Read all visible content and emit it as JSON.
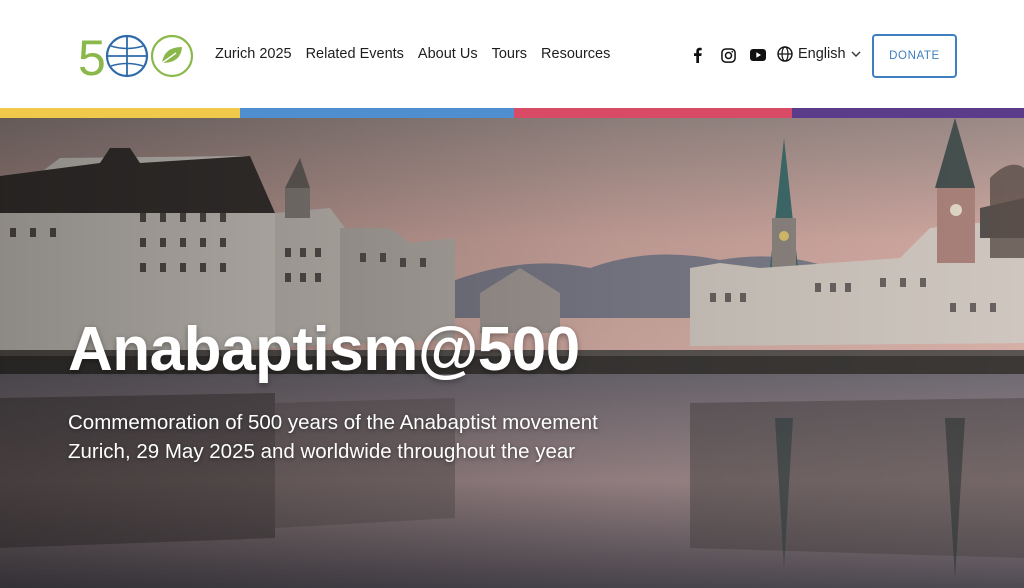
{
  "logo": {
    "text": "5",
    "icon_names": [
      "globe-icon",
      "leaf-icon"
    ]
  },
  "nav": {
    "items": [
      "Zurich 2025",
      "Related Events",
      "About Us",
      "Tours",
      "Resources"
    ]
  },
  "social": [
    "facebook-icon",
    "instagram-icon",
    "youtube-icon"
  ],
  "language": {
    "icon": "globe-icon",
    "label": "English",
    "dropdown_icon": "chevron-down-icon"
  },
  "donate": {
    "label": "DONATE"
  },
  "strip_colors": [
    "#f1c94a",
    "#4f8fd0",
    "#d94a66",
    "#5b3c8a"
  ],
  "colors": {
    "accent": "#3d7fc0",
    "logo_green": "#8ab84a",
    "logo_blue": "#2f6aa8"
  },
  "hero": {
    "title": "Anabaptism@500",
    "subtitle_line1": "Commemoration of 500 years of the Anabaptist movement",
    "subtitle_line2": "Zurich, 29 May 2025 and worldwide throughout the year"
  }
}
